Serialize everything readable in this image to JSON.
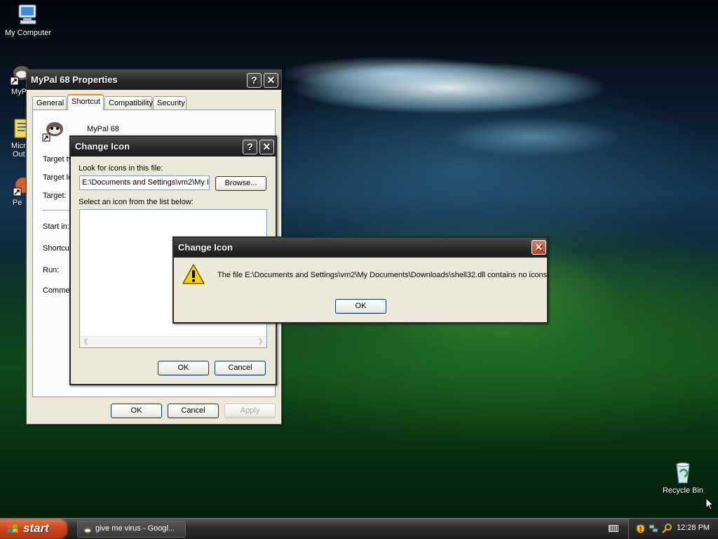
{
  "desktop": {
    "icons": [
      {
        "label": "My Computer",
        "icon": "my-computer-icon"
      },
      {
        "label": "MyP",
        "icon": "mypal-shortcut-icon"
      },
      {
        "label": "Micr",
        "label2": "Out",
        "icon": "outlook-shortcut-icon"
      },
      {
        "label": "Pe",
        "icon": "shortcut-icon"
      },
      {
        "label": "Recycle Bin",
        "icon": "recycle-bin-icon"
      }
    ]
  },
  "properties": {
    "title": "MyPal 68 Properties",
    "tabs": [
      "General",
      "Shortcut",
      "Compatibility",
      "Security"
    ],
    "name": "MyPal 68",
    "labels": [
      "Target ty",
      "Target lo",
      "Target:",
      "Start in:",
      "Shortcu",
      "Run:",
      "Commen"
    ],
    "ok": "OK",
    "cancel": "Cancel",
    "apply": "Apply"
  },
  "change_icon": {
    "title": "Change Icon",
    "look_label": "Look for icons in this file:",
    "path": "E:\\Documents and Settings\\vm2\\My I",
    "browse": "Browse...",
    "select_label": "Select an icon from the list below:",
    "ok": "OK",
    "cancel": "Cancel"
  },
  "alert": {
    "title": "Change Icon",
    "message": "The file E:\\Documents and Settings\\vm2\\My Documents\\Downloads\\shell32.dll contains no icons.",
    "ok": "OK"
  },
  "taskbar": {
    "start": "start",
    "task": "give me virus - Googl...",
    "time": "12:28 PM"
  },
  "colors": {
    "warning": "#f5d20c",
    "start": "#d9521f"
  }
}
